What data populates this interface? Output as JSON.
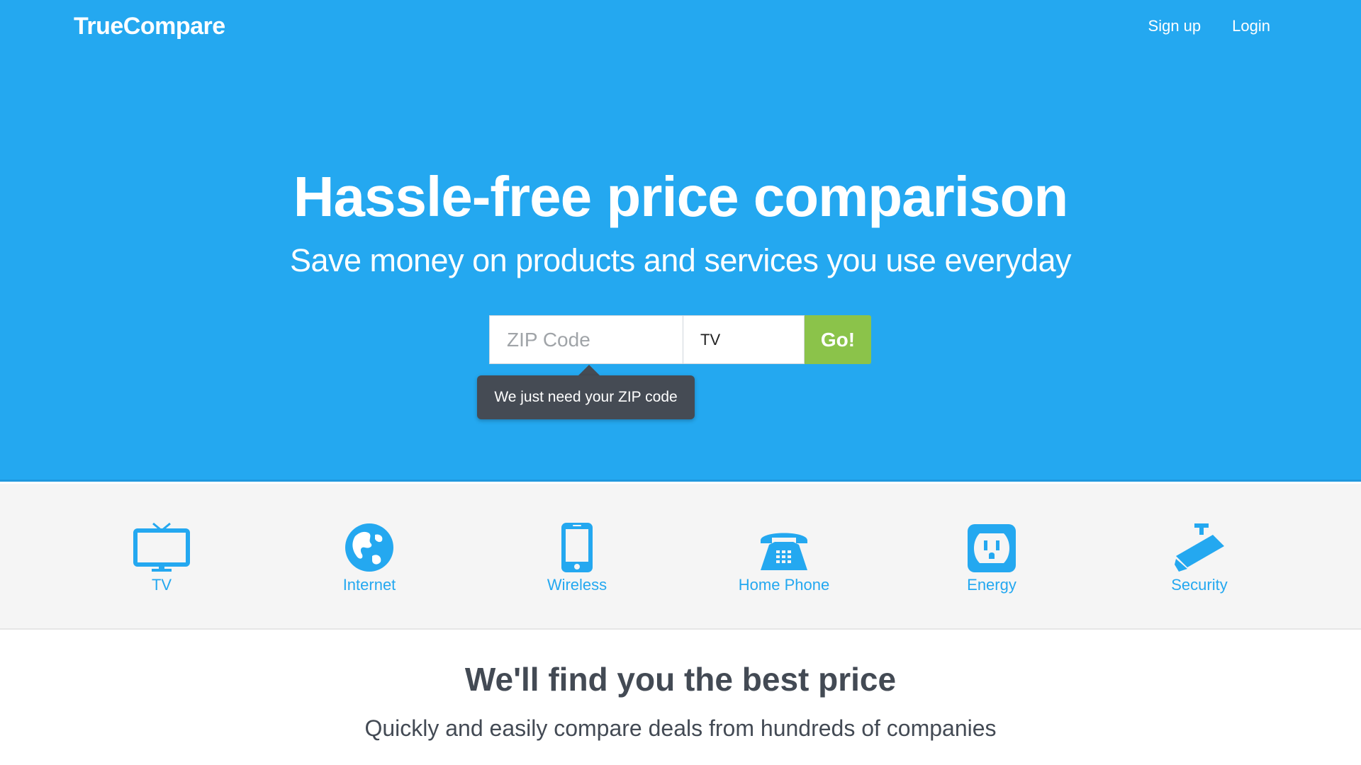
{
  "header": {
    "brand": "TrueCompare",
    "nav": {
      "signup": "Sign up",
      "login": "Login"
    }
  },
  "hero": {
    "headline": "Hassle-free price comparison",
    "subhead": "Save money on products and services you use everyday",
    "search": {
      "zip_placeholder": "ZIP Code",
      "zip_value": "",
      "service_value": "TV",
      "go_label": "Go!"
    },
    "tooltip": "We just need your ZIP code"
  },
  "categories": [
    {
      "label": "TV",
      "icon": "tv-icon"
    },
    {
      "label": "Internet",
      "icon": "globe-icon"
    },
    {
      "label": "Wireless",
      "icon": "smartphone-icon"
    },
    {
      "label": "Home Phone",
      "icon": "telephone-icon"
    },
    {
      "label": "Energy",
      "icon": "power-outlet-icon"
    },
    {
      "label": "Security",
      "icon": "security-camera-icon"
    }
  ],
  "promo": {
    "title": "We'll find you the best price",
    "subtitle": "Quickly and easily compare deals from hundreds of companies"
  },
  "colors": {
    "hero_bg": "#24a8f0",
    "go_button": "#8bc34a",
    "tooltip_bg": "#454b54",
    "category_accent": "#24a8f0",
    "heading_text": "#434a54"
  }
}
